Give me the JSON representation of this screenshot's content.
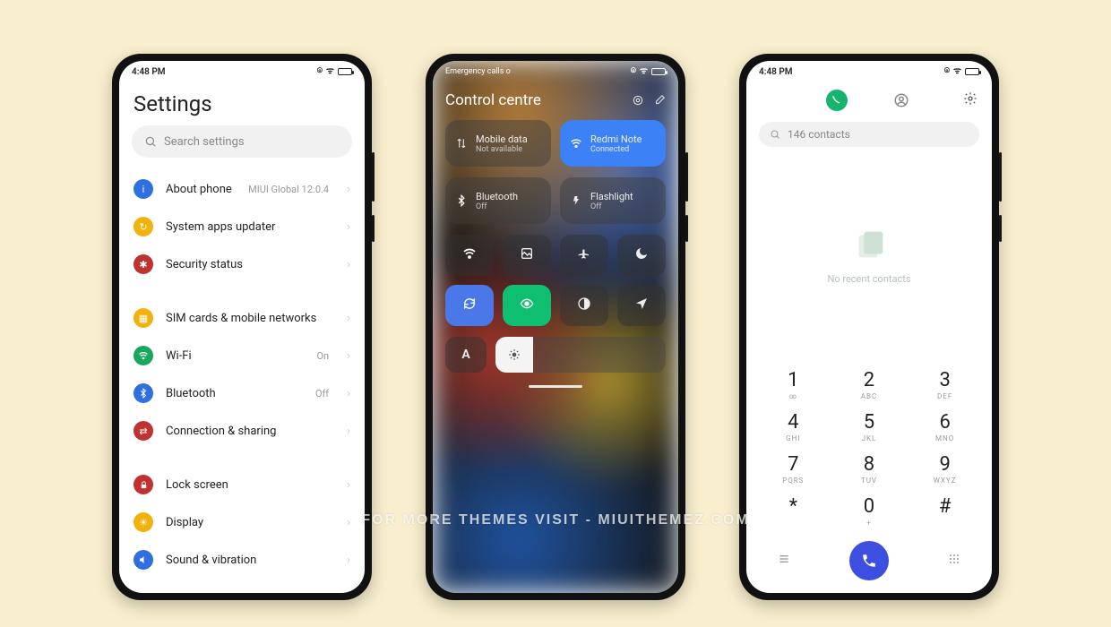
{
  "status_time": "4:48 PM",
  "settings": {
    "title": "Settings",
    "search_placeholder": "Search settings",
    "groups": [
      [
        {
          "icon_color": "#2f6fe0",
          "icon": "i",
          "label": "About phone",
          "value": "MIUI Global 12.0.4"
        },
        {
          "icon_color": "#f2b20c",
          "icon": "↻",
          "label": "System apps updater",
          "value": ""
        },
        {
          "icon_color": "#c03232",
          "icon": "✱",
          "label": "Security status",
          "value": ""
        }
      ],
      [
        {
          "icon_color": "#f2b20c",
          "icon": "▦",
          "label": "SIM cards & mobile networks",
          "value": ""
        },
        {
          "icon_color": "#17a85e",
          "icon": "wifi",
          "label": "Wi-Fi",
          "value": "On"
        },
        {
          "icon_color": "#2f6fe0",
          "icon": "bt",
          "label": "Bluetooth",
          "value": "Off"
        },
        {
          "icon_color": "#c03232",
          "icon": "⇄",
          "label": "Connection & sharing",
          "value": ""
        }
      ],
      [
        {
          "icon_color": "#c03232",
          "icon": "lock",
          "label": "Lock screen",
          "value": ""
        },
        {
          "icon_color": "#f2b20c",
          "icon": "☀",
          "label": "Display",
          "value": ""
        },
        {
          "icon_color": "#2f6fe0",
          "icon": "vol",
          "label": "Sound & vibration",
          "value": ""
        }
      ]
    ]
  },
  "control_centre": {
    "emergency_text": "Emergency calls o",
    "title": "Control centre",
    "wide_tiles": [
      {
        "id": "mobile-data",
        "icon": "data",
        "line1": "Mobile data",
        "line2": "Not available",
        "active": false
      },
      {
        "id": "wifi",
        "icon": "wifi",
        "line1": "Redmi Note",
        "line2": "Connected",
        "active": true
      }
    ],
    "wide_tiles_2": [
      {
        "id": "bluetooth",
        "icon": "bt",
        "line1": "Bluetooth",
        "line2": "Off",
        "active": false
      },
      {
        "id": "flashlight",
        "icon": "flash",
        "line1": "Flashlight",
        "line2": "Off",
        "active": false
      }
    ],
    "grid": [
      {
        "id": "wifi-small",
        "icon": "wifi",
        "variant": ""
      },
      {
        "id": "screenshot",
        "icon": "shot",
        "variant": ""
      },
      {
        "id": "airplane",
        "icon": "plane",
        "variant": ""
      },
      {
        "id": "dnd",
        "icon": "moon",
        "variant": ""
      },
      {
        "id": "rotate",
        "icon": "rotate",
        "variant": "blue"
      },
      {
        "id": "read",
        "icon": "eye",
        "variant": "green"
      },
      {
        "id": "dark",
        "icon": "contrast",
        "variant": ""
      },
      {
        "id": "location",
        "icon": "nav",
        "variant": ""
      }
    ],
    "auto_brightness_label": "A",
    "brightness_percent": 22
  },
  "dialer": {
    "search_text": "146 contacts",
    "empty_text": "No recent contacts",
    "keys": [
      {
        "n": "1",
        "s": "∞"
      },
      {
        "n": "2",
        "s": "ABC"
      },
      {
        "n": "3",
        "s": "DEF"
      },
      {
        "n": "4",
        "s": "GHI"
      },
      {
        "n": "5",
        "s": "JKL"
      },
      {
        "n": "6",
        "s": "MNO"
      },
      {
        "n": "7",
        "s": "PQRS"
      },
      {
        "n": "8",
        "s": "TUV"
      },
      {
        "n": "9",
        "s": "WXYZ"
      },
      {
        "n": "*",
        "s": ""
      },
      {
        "n": "0",
        "s": "+"
      },
      {
        "n": "#",
        "s": ""
      }
    ]
  },
  "watermark": "FOR MORE THEMES VISIT - MIUITHEMEZ.COM"
}
